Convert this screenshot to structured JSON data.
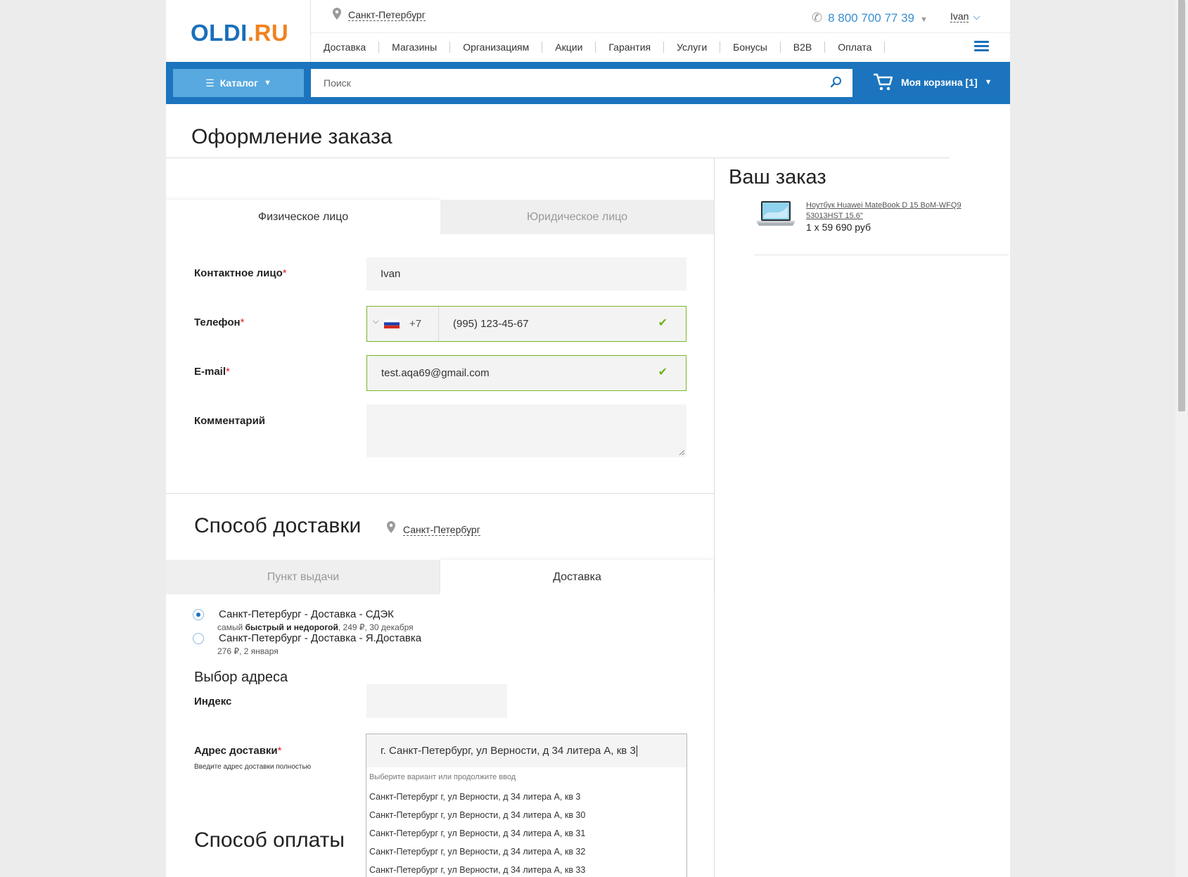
{
  "header": {
    "logo_main": "OLDI",
    "logo_tld": ".RU",
    "city": "Санкт-Петербург",
    "phone": "8 800 700 77 39",
    "user": "Ivan",
    "nav": [
      "Доставка",
      "Магазины",
      "Организациям",
      "Акции",
      "Гарантия",
      "Услуги",
      "Бонусы",
      "B2B",
      "Оплата"
    ]
  },
  "toolbar": {
    "catalog_label": "Каталог",
    "search_placeholder": "Поиск",
    "cart_label": "Моя корзина [1]"
  },
  "page": {
    "title": "Оформление заказа"
  },
  "customer_tabs": {
    "individual": "Физическое лицо",
    "legal": "Юридическое лицо",
    "active": "individual"
  },
  "form": {
    "contact_label": "Контактное лицо",
    "contact_value": "Ivan",
    "phone_label": "Телефон",
    "phone_code": "+7",
    "phone_value": "(995) 123-45-67",
    "email_label": "E-mail",
    "email_value": "test.aqa69@gmail.com",
    "comment_label": "Комментарий",
    "comment_value": "",
    "required_mark": "*"
  },
  "delivery": {
    "title": "Способ доставки",
    "city": "Санкт-Петербург",
    "tabs": {
      "pickup": "Пункт выдачи",
      "courier": "Доставка",
      "active": "courier"
    },
    "options": [
      {
        "title": "Санкт-Петербург - Доставка - СДЭК",
        "sub_prefix": "самый ",
        "sub_bold": "быстрый и недорогой",
        "sub_suffix": ", 249 ₽, 30 декабря",
        "selected": true
      },
      {
        "title": "Санкт-Петербург - Доставка - Я.Доставка",
        "sub_prefix": "276 ₽, 2 января",
        "selected": false
      }
    ],
    "address_section_title": "Выбор адреса",
    "index_label": "Индекс",
    "index_value": "",
    "address_label": "Адрес доставки",
    "address_hint": "Введите адрес доставки полностью",
    "address_value": "г. Санкт-Петербург, ул Верности, д 34 литера А, кв 3",
    "suggest_header": "Выберите вариант или продолжите ввод",
    "suggestions": [
      "Санкт-Петербург г, ул Верности, д 34 литера А, кв 3",
      "Санкт-Петербург г, ул Верности, д 34 литера А, кв 30",
      "Санкт-Петербург г, ул Верности, д 34 литера А, кв 31",
      "Санкт-Петербург г, ул Верности, д 34 литера А, кв 32",
      "Санкт-Петербург г, ул Верности, д 34 литера А, кв 33"
    ]
  },
  "payment": {
    "title": "Способ оплаты"
  },
  "order": {
    "title": "Ваш заказ",
    "product_name": "Ноутбук Huawei MateBook D 15 BoM-WFQ9 53013HST 15.6\"",
    "product_price": "1 x 59 690 руб"
  },
  "colors": {
    "brand_blue": "#1b74bd",
    "light_blue": "#57a9e0",
    "accent_orange": "#f0821e",
    "valid_green": "#7ab828"
  }
}
